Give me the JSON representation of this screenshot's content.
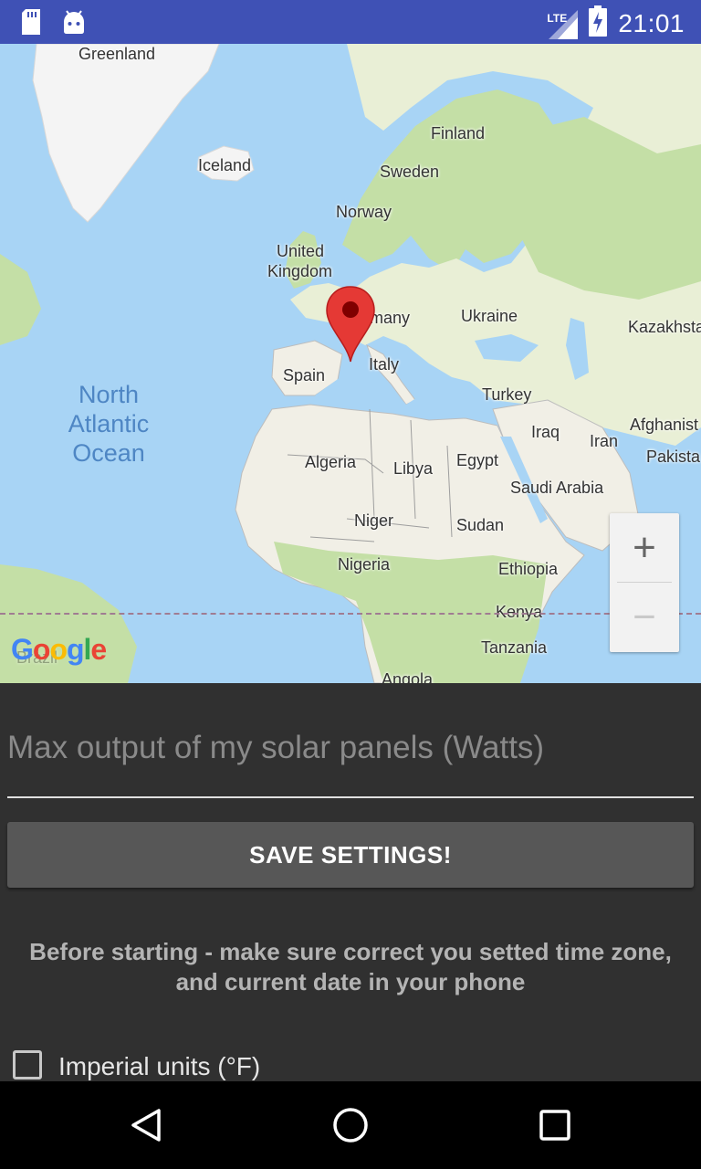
{
  "status_bar": {
    "time": "21:01",
    "network": "LTE",
    "icons": [
      "sd-card-icon",
      "android-icon",
      "signal-icon",
      "battery-charging-icon"
    ]
  },
  "map": {
    "labels": {
      "greenland": "Greenland",
      "iceland": "Iceland",
      "finland": "Finland",
      "sweden": "Sweden",
      "norway": "Norway",
      "uk_line1": "United",
      "uk_line2": "Kingdom",
      "germany": "many",
      "ukraine": "Ukraine",
      "kazakhstan": "Kazakhsta",
      "spain": "Spain",
      "italy": "Italy",
      "turkey": "Turkey",
      "iraq": "Iraq",
      "iran": "Iran",
      "afghanistan": "Afghanist",
      "pakistan": "Pakista",
      "algeria": "Algeria",
      "libya": "Libya",
      "egypt": "Egypt",
      "saudi_arabia": "Saudi Arabia",
      "niger": "Niger",
      "sudan": "Sudan",
      "nigeria": "Nigeria",
      "ethiopia": "Ethiopia",
      "kenya": "Kenya",
      "tanzania": "Tanzania",
      "angola": "Angola",
      "brazil": "Brazil"
    },
    "ocean": [
      "North",
      "Atlantic",
      "Ocean"
    ],
    "attribution": "Google",
    "zoom_in": "+",
    "zoom_out": "−"
  },
  "form": {
    "max_output_placeholder": "Max output of my solar panels (Watts)",
    "save_button": "SAVE SETTINGS!",
    "note": "Before starting - make sure correct you setted time zone, and current date in your phone",
    "imperial_label": "Imperial units (°F)",
    "imperial_checked": false
  },
  "colors": {
    "status_bar": "#3f51b5",
    "background": "#303030",
    "button": "#575757",
    "water": "#a8d4f5",
    "land": "#f1efe6",
    "vegetation": "#c4dfa6",
    "pin": "#e53935"
  }
}
